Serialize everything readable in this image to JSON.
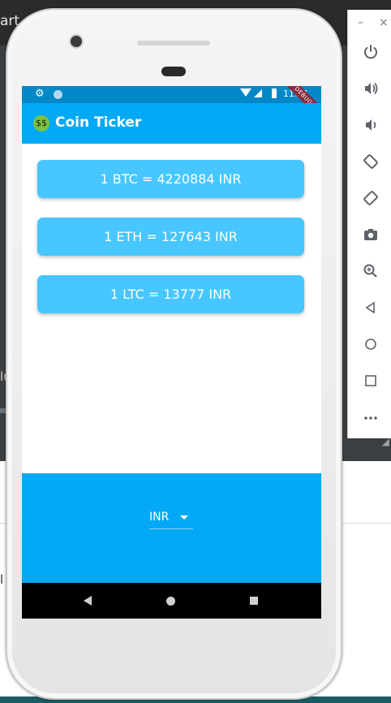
{
  "background": {
    "ide_title_fragment": "art",
    "side_fragment_a": "lu",
    "side_fragment_b": "l"
  },
  "emulator_toolbar": {
    "minimize": "–",
    "close": "×",
    "buttons": [
      {
        "icon": "power-icon",
        "glyph": "⏻"
      },
      {
        "icon": "volume-up-icon",
        "glyph": "🔊"
      },
      {
        "icon": "volume-down-icon",
        "glyph": "🔉"
      },
      {
        "icon": "rotate-left-icon",
        "glyph": "⟲"
      },
      {
        "icon": "rotate-right-icon",
        "glyph": "⟳"
      },
      {
        "icon": "camera-icon",
        "glyph": "📷"
      },
      {
        "icon": "zoom-icon",
        "glyph": "⊕"
      },
      {
        "icon": "back-icon",
        "glyph": "◁"
      },
      {
        "icon": "home-icon",
        "glyph": "○"
      },
      {
        "icon": "overview-icon",
        "glyph": "□"
      },
      {
        "icon": "more-icon",
        "glyph": "•••"
      }
    ]
  },
  "status_bar": {
    "time": "11:01",
    "debug_label": "DEBUG",
    "color": "#0288c7"
  },
  "app_bar": {
    "emoji": "🤑",
    "title": "Coin Ticker",
    "color": "#03a9f4"
  },
  "rates": [
    {
      "text": "1 BTC = 4220884 INR"
    },
    {
      "text": "1 ETH = 127643 INR"
    },
    {
      "text": "1 LTC = 13777 INR"
    }
  ],
  "currency_picker": {
    "selected": "INR"
  },
  "colors": {
    "card": "#47c6ff",
    "primary": "#03a9f4",
    "accent_dark": "#0288c7"
  }
}
